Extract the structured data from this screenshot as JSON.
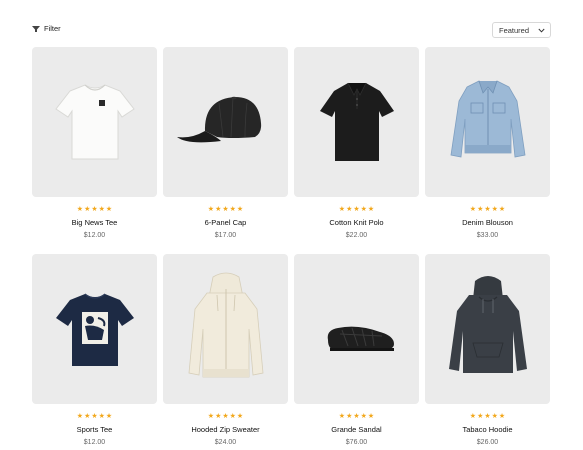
{
  "toolbar": {
    "filter_label": "Filter",
    "sort_value": "Featured"
  },
  "products": [
    {
      "name": "Big News Tee",
      "price": "$12.00",
      "rating": 5,
      "image_icon": "white-tshirt-icon"
    },
    {
      "name": "6-Panel Cap",
      "price": "$17.00",
      "rating": 5,
      "image_icon": "black-cap-icon"
    },
    {
      "name": "Cotton Knit Polo",
      "price": "$22.00",
      "rating": 5,
      "image_icon": "black-polo-icon"
    },
    {
      "name": "Denim Blouson",
      "price": "$33.00",
      "rating": 5,
      "image_icon": "denim-jacket-icon"
    },
    {
      "name": "Sports Tee",
      "price": "$12.00",
      "rating": 5,
      "image_icon": "navy-graphic-tee-icon"
    },
    {
      "name": "Hooded Zip Sweater",
      "price": "$24.00",
      "rating": 5,
      "image_icon": "cream-zip-hoodie-icon"
    },
    {
      "name": "Grande Sandal",
      "price": "$76.00",
      "rating": 5,
      "image_icon": "black-sandal-icon"
    },
    {
      "name": "Tabaco Hoodie",
      "price": "$26.00",
      "rating": 5,
      "image_icon": "charcoal-hoodie-icon"
    }
  ],
  "colors": {
    "card_background": "#ebebeb",
    "star": "#f2a81d",
    "price_text": "#666666"
  }
}
